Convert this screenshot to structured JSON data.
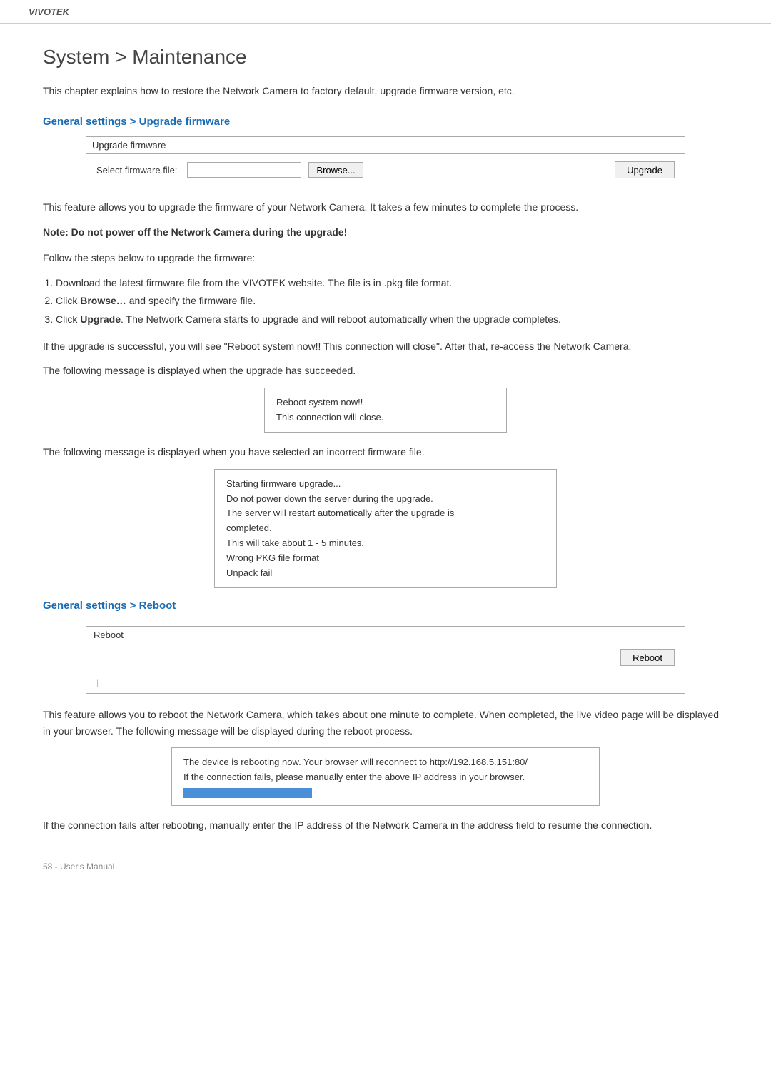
{
  "brand": "VIVOTEK",
  "page_title": "System > Maintenance",
  "intro": "This chapter explains how to restore the Network Camera to factory default, upgrade firmware version, etc.",
  "section1_heading": "General settings > Upgrade firmware",
  "firmware_box": {
    "title": "Upgrade firmware",
    "label": "Select firmware file:",
    "input_value": "",
    "browse_label": "Browse...",
    "upgrade_label": "Upgrade"
  },
  "firmware_desc1": "This feature allows you to upgrade the firmware of your Network Camera. It takes a few minutes to complete the process.",
  "firmware_note": "Note: Do not power off the Network Camera during the upgrade!",
  "steps_intro": "Follow the steps below to upgrade the firmware:",
  "steps": [
    "Download the latest firmware file from the VIVOTEK website. The file is in .pkg file format.",
    "Click Browse… and specify the firmware file.",
    "Click Upgrade. The Network Camera starts to upgrade and will reboot automatically when the upgrade completes."
  ],
  "after_upgrade_text": "If the upgrade is successful, you will see \"Reboot system now!! This connection will close\". After that, re-access the Network Camera.",
  "following_message1": "The following message is displayed when the upgrade has succeeded.",
  "success_message_line1": "Reboot system now!!",
  "success_message_line2": "This connection will close.",
  "following_message2": "The following message is displayed when you have selected an incorrect firmware file.",
  "error_message_lines": [
    "Starting firmware upgrade...",
    "Do not power down the server during the upgrade.",
    "The server will restart automatically after the upgrade is",
    "completed.",
    "This will take about 1 - 5 minutes.",
    "Wrong PKG file format",
    "Unpack fail"
  ],
  "section2_heading": "General settings > Reboot",
  "reboot_box": {
    "title": "Reboot",
    "reboot_label": "Reboot"
  },
  "reboot_desc": "This feature allows you to reboot the Network Camera, which takes about one minute to complete. When completed, the live video page will be displayed in your browser. The following message will be displayed during the reboot process.",
  "reboot_message_line1": "The device is rebooting now. Your browser will reconnect to http://192.168.5.151:80/",
  "reboot_message_line2": "If the connection fails, please manually enter the above IP address in your browser.",
  "reboot_after_text": "If the connection fails after rebooting, manually enter the IP address of the Network Camera in the address field to resume the connection.",
  "footer": "58 - User's Manual"
}
